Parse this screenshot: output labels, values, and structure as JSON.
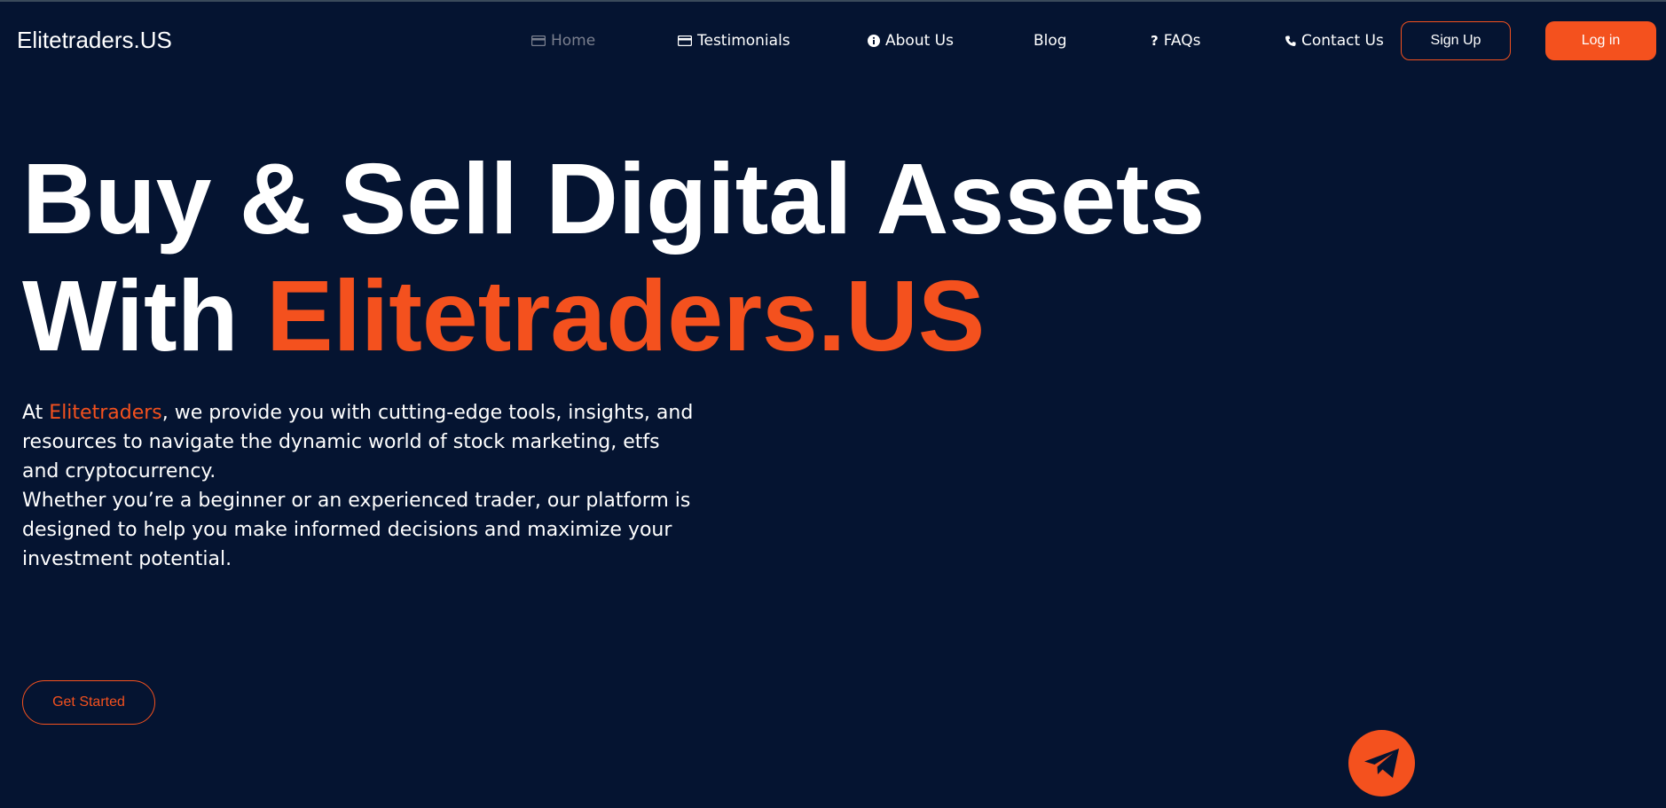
{
  "brand": {
    "name": "Elitetraders.US"
  },
  "nav": {
    "items": [
      {
        "label": "Home",
        "icon": "card-icon",
        "active": true
      },
      {
        "label": "Testimonials",
        "icon": "card-icon",
        "active": false
      },
      {
        "label": "About Us",
        "icon": "info-circle-icon",
        "active": false
      },
      {
        "label": "Blog",
        "icon": "",
        "active": false
      },
      {
        "label": "FAQs",
        "icon": "question-icon",
        "active": false
      },
      {
        "label": "Contact Us",
        "icon": "phone-icon",
        "active": false
      }
    ],
    "signup_label": "Sign Up",
    "login_label": "Log in"
  },
  "hero": {
    "title_line1": "Buy & Sell Digital Assets",
    "title_line2_prefix": "With ",
    "title_line2_accent": "Elitetraders.US",
    "desc_prefix": "At ",
    "desc_accent": "Elitetraders",
    "desc_rest": ", we provide you with cutting-edge tools, insights, and resources to navigate the dynamic world of stock marketing, etfs and cryptocurrency.",
    "desc_para2": "Whether you’re a beginner or an experienced trader, our platform is designed to help you make informed decisions and maximize your investment potential.",
    "cta_label": "Get Started"
  },
  "floating": {
    "icon": "telegram-paper-plane-icon"
  },
  "colors": {
    "background": "#051431",
    "accent": "#f4511e",
    "text": "#ffffff",
    "nav_active": "#7a7f8e"
  }
}
